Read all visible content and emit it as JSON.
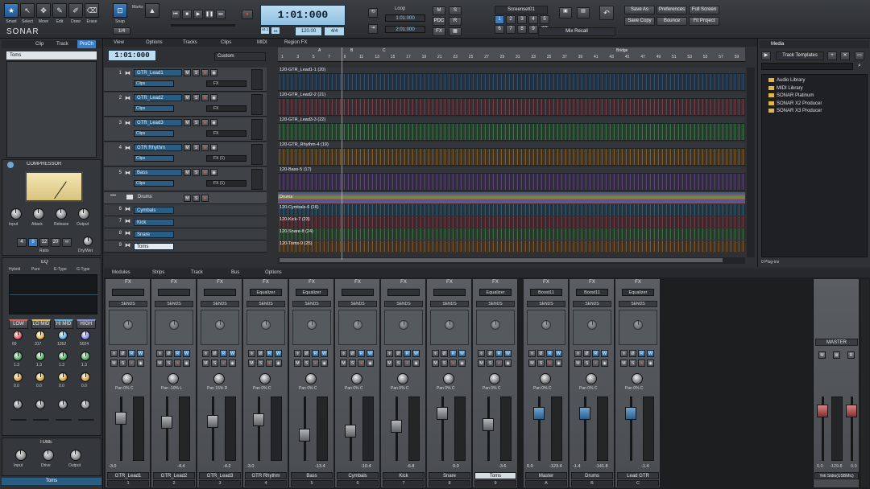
{
  "app": {
    "logo": "SONAR"
  },
  "tools": [
    {
      "label": "Smart",
      "icon": "star-icon",
      "glyph": "★"
    },
    {
      "label": "Select",
      "icon": "arrow-icon",
      "glyph": "↖"
    },
    {
      "label": "Move",
      "icon": "move-icon",
      "glyph": "✥"
    },
    {
      "label": "Edit",
      "icon": "edit-icon",
      "glyph": "✎"
    },
    {
      "label": "Draw",
      "icon": "pencil-icon",
      "glyph": "✐"
    },
    {
      "label": "Erase",
      "icon": "eraser-icon",
      "glyph": "⌫"
    }
  ],
  "snap": {
    "label": "Snap",
    "value": "1/4",
    "marks": "Marks"
  },
  "transport": {
    "time": "1:01:000",
    "tempo": "120.00",
    "meter": "4/4",
    "small_lcd": [
      "44.1",
      "16"
    ],
    "loop_label": "Loop",
    "loop_start": "1:01:000",
    "loop_end": "2:01:000"
  },
  "screenset": {
    "label": "Screenset01",
    "numbers": [
      "1",
      "2",
      "3",
      "4",
      "5",
      "6",
      "7",
      "8",
      "9",
      "10"
    ]
  },
  "mix_recall": "Mix Recall",
  "top_buttons": [
    "Save As",
    "Save Copy",
    "Preferences",
    "Bounce",
    "Full Screen",
    "Fit Project"
  ],
  "small_buttons": [
    "M",
    "S",
    "R",
    "PDC",
    "FX"
  ],
  "inspector": {
    "tabs": [
      "Clip",
      "Track",
      "ProCh"
    ],
    "track": "Toms",
    "compressor": {
      "title": "COMPRESSOR",
      "knobs": [
        "Input",
        "Attack",
        "Release",
        "Output"
      ],
      "ratios": [
        "4",
        "8",
        "12",
        "20",
        "∞"
      ],
      "ratio_label": "Ratio",
      "drywet": "Dry/Wet"
    },
    "eq": {
      "title": "EQ",
      "modes": [
        "Hybrid",
        "Pure",
        "E-Type",
        "G-Type"
      ],
      "bands": [
        "LOW",
        "LO MID",
        "HI MID",
        "HIGH"
      ],
      "freqs": [
        "69",
        "317",
        "1262",
        "5024"
      ],
      "gains": [
        "1.3",
        "1.3",
        "1.3",
        "1.3"
      ],
      "qs": [
        "0.0",
        "0.0",
        "0.0",
        "0.0"
      ]
    },
    "tube": {
      "title": "TUBE",
      "knobs": [
        "Input",
        "Drive",
        "Output"
      ]
    },
    "bottom_name": "Toms"
  },
  "trackview": {
    "menus": [
      "View",
      "Options",
      "Tracks",
      "Clips",
      "MIDI",
      "Region FX"
    ],
    "time": "1:01:000",
    "custom": "Custom",
    "tracks": [
      {
        "num": "1",
        "name": "GTR_Lead1",
        "clips": "Clips",
        "fx": "FX",
        "clip": "120-GTR_Lead1-1 (20)",
        "color": "#3c78b5"
      },
      {
        "num": "2",
        "name": "GTR_Lead2",
        "clips": "Clips",
        "fx": "FX",
        "clip": "120-GTR_Lead2-2 (21)",
        "color": "#c05a6a"
      },
      {
        "num": "3",
        "name": "GTR_Lead3",
        "clips": "Clips",
        "fx": "FX",
        "clip": "120-GTR_Lead3-3 (22)",
        "color": "#4fbf63"
      },
      {
        "num": "4",
        "name": "GTR Rhythm",
        "clips": "Clips",
        "fx": "FX (1)",
        "clip": "120-GTR_Rhythm-4 (19)",
        "color": "#d8902a"
      },
      {
        "num": "5",
        "name": "Bass",
        "clips": "Clips",
        "fx": "FX (1)",
        "clip": "120-Bass-5 (17)",
        "color": "#9160c0"
      }
    ],
    "folder": {
      "name": "Drums",
      "clip": "Drums"
    },
    "subtracks": [
      {
        "num": "6",
        "name": "Cymbals",
        "clip": "120-Cymbals-6 (16)",
        "color": "#3e8ec0"
      },
      {
        "num": "7",
        "name": "Kick",
        "clip": "120-Kick-7 (23)",
        "color": "#c74a5c"
      },
      {
        "num": "8",
        "name": "Snare",
        "clip": "120-Snare-8 (24)",
        "color": "#58b05c"
      },
      {
        "num": "9",
        "name": "Toms",
        "clip": "120-Toms-9 (25)",
        "color": "#d6862a"
      }
    ],
    "ruler": [
      "1",
      "3",
      "5",
      "7",
      "9",
      "11",
      "13",
      "15",
      "17",
      "19",
      "21",
      "23",
      "25",
      "27",
      "29",
      "31",
      "33",
      "35",
      "37",
      "39",
      "41",
      "43",
      "45",
      "47",
      "49",
      "51",
      "53",
      "55",
      "57",
      "59"
    ],
    "markers": [
      "A",
      "B",
      "C",
      "Bridge"
    ]
  },
  "browser": {
    "tab": "Media",
    "templates": "Track Templates",
    "folders": [
      "Audio Library",
      "MIDI Library",
      "SONAR Platinum",
      "SONAR X2 Producer",
      "SONAR X3 Producer"
    ],
    "footer": "0 Plug-ins"
  },
  "mixer": {
    "menus": [
      "Modules",
      "Strips",
      "Track",
      "Bus",
      "Options"
    ],
    "strips": [
      {
        "fx": "FX",
        "plugin": "",
        "sends": "SENDS",
        "pan": "Pan 0% C",
        "val_l": "-3.0",
        "val_r": "",
        "name": "GTR_Lead1",
        "num": "1",
        "cap": "grey",
        "faderpos": 0.3
      },
      {
        "fx": "FX",
        "plugin": "",
        "sends": "SENDS",
        "pan": "Pan -10% L",
        "val_l": "",
        "val_r": "-4.4",
        "name": "GTR_Lead2",
        "num": "2",
        "cap": "grey",
        "faderpos": 0.38
      },
      {
        "fx": "FX",
        "plugin": "",
        "sends": "SENDS",
        "pan": "Pan 15% R",
        "val_l": "",
        "val_r": "-4.2",
        "name": "GTR_Lead3",
        "num": "3",
        "cap": "grey",
        "faderpos": 0.36
      },
      {
        "fx": "FX",
        "plugin": "Equalizer",
        "sends": "SENDS",
        "pan": "Pan 0% C",
        "val_l": "-3.0",
        "val_r": "",
        "name": "GTR Rhythm",
        "num": "4",
        "cap": "grey",
        "faderpos": 0.33
      },
      {
        "fx": "FX",
        "plugin": "Equalizer",
        "sends": "SENDS",
        "pan": "Pan 0% C",
        "val_l": "",
        "val_r": "-13.4",
        "name": "Bass",
        "num": "5",
        "cap": "grey",
        "faderpos": 0.62
      },
      {
        "fx": "FX",
        "plugin": "",
        "sends": "SENDS",
        "pan": "Pan 0% C",
        "val_l": "",
        "val_r": "-10.4",
        "name": "Cymbals",
        "num": "6",
        "cap": "grey",
        "faderpos": 0.55
      },
      {
        "fx": "FX",
        "plugin": "",
        "sends": "SENDS",
        "pan": "Pan 0% C",
        "val_l": "",
        "val_r": "-6.8",
        "name": "Kick",
        "num": "7",
        "cap": "grey",
        "faderpos": 0.45
      },
      {
        "fx": "FX",
        "plugin": "",
        "sends": "SENDS",
        "pan": "Pan 0% C",
        "val_l": "",
        "val_r": "0.0",
        "name": "Snare",
        "num": "8",
        "cap": "grey",
        "faderpos": 0.2
      },
      {
        "fx": "FX",
        "plugin": "Equalizer",
        "sends": "SENDS",
        "pan": "Pan 0% C",
        "val_l": "",
        "val_r": "-3.6",
        "name": "Toms",
        "num": "9",
        "cap": "grey",
        "faderpos": 0.42,
        "selected": true
      },
      {
        "fx": "FX",
        "plugin": "Boost11",
        "sends": "SENDS",
        "pan": "Pan 0% C",
        "val_l": "0.0",
        "val_r": "-123.4",
        "name": "Master",
        "num": "A",
        "cap": "blue",
        "faderpos": 0.2
      },
      {
        "fx": "FX",
        "plugin": "Boost11",
        "sends": "SENDS",
        "pan": "Pan 0% C",
        "val_l": "-1.4",
        "val_r": "-141.8",
        "name": "Drums",
        "num": "B",
        "cap": "blue",
        "faderpos": 0.2
      },
      {
        "fx": "FX",
        "plugin": "Equalizer",
        "sends": "SENDS",
        "pan": "Pan 0% C",
        "val_l": "",
        "val_r": "-1.4",
        "name": "Lead GTR",
        "num": "C",
        "cap": "blue",
        "faderpos": 0.2
      }
    ],
    "master": {
      "title": "MASTER",
      "val_l": "0.0",
      "val_m": "-129.8",
      "val_r": "0.0",
      "output": "Yeti Stdio(USBMic)"
    }
  }
}
